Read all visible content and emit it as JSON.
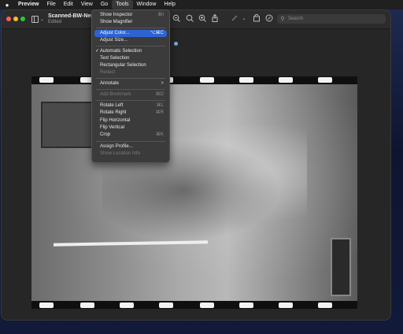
{
  "menubar": {
    "items": [
      "Preview",
      "File",
      "Edit",
      "View",
      "Go",
      "Tools",
      "Window",
      "Help"
    ]
  },
  "window": {
    "title": "Scanned-BW-Negat",
    "subtitle": "Edited"
  },
  "toolbar": {
    "search_placeholder": "Search"
  },
  "tools_menu": {
    "items": [
      {
        "label": "Show Inspector",
        "shortcut": "⌘I"
      },
      {
        "label": "Show Magnifier",
        "shortcut": ""
      },
      {
        "label": "Adjust Color...",
        "shortcut": "⌥⌘C"
      },
      {
        "label": "Adjust Size...",
        "shortcut": ""
      },
      {
        "label": "Automatic Selection",
        "shortcut": ""
      },
      {
        "label": "Text Selection",
        "shortcut": ""
      },
      {
        "label": "Rectangular Selection",
        "shortcut": ""
      },
      {
        "label": "Redact",
        "shortcut": ""
      },
      {
        "label": "Annotate",
        "shortcut": ">"
      },
      {
        "label": "Add Bookmark",
        "shortcut": "⌘D"
      },
      {
        "label": "Rotate Left",
        "shortcut": "⌘L"
      },
      {
        "label": "Rotate Right",
        "shortcut": "⌘R"
      },
      {
        "label": "Flip Horizontal",
        "shortcut": ""
      },
      {
        "label": "Flip Vertical",
        "shortcut": ""
      },
      {
        "label": "Crop",
        "shortcut": "⌘K"
      },
      {
        "label": "Assign Profile...",
        "shortcut": ""
      },
      {
        "label": "Show Location Info",
        "shortcut": ""
      }
    ]
  },
  "colors": {
    "highlight": "#2d63d3",
    "menubar": "#202020",
    "window": "#262626"
  },
  "icons": [
    "apple-logo",
    "sidebar-toggle",
    "zoom-out-icon",
    "zoom-in-icon",
    "share-icon",
    "markup-icon",
    "rotate-icon",
    "search-icon"
  ]
}
